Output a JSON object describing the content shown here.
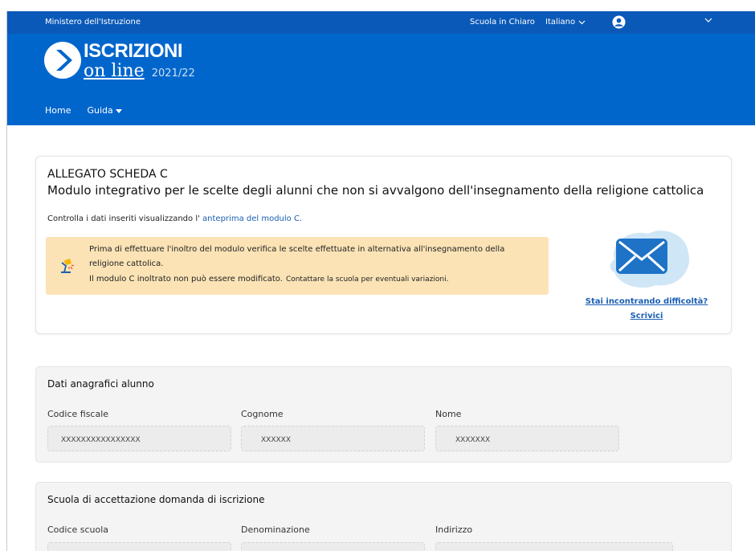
{
  "header": {
    "ministry": "Ministero dell'Istruzione",
    "scuola_link": "Scuola in Chiaro",
    "language": "Italiano",
    "brand_title": "ISCRIZIONI",
    "brand_subtitle": "on line",
    "brand_year": "2021/22",
    "nav": {
      "home": "Home",
      "guida": "Guida"
    }
  },
  "notice": {
    "tag": "ALLEGATO SCHEDA C",
    "title": "Modulo integrativo per le scelte degli alunni che non si avvalgono dell'insegnamento della religione cattolica",
    "check_prefix": "Controlla i dati inseriti visualizzando l'",
    "check_link": "anteprima del modulo C.",
    "warning_line1": "Prima di effettuare l'inoltro del modulo verifica le scelte effettuate in alternativa all'insegnamento della",
    "warning_line2": "religione cattolica.",
    "warning_line3a": "Il modulo C inoltrato non può essere modificato.",
    "warning_line3b": "Contattare la scuola per eventuali variazioni.",
    "help_line1": "Stai incontrando difficoltà?",
    "help_line2": "Scrivici"
  },
  "student": {
    "title": "Dati anagrafici alunno",
    "fields": [
      {
        "label": "Codice fiscale",
        "value": "XXXXXXXXXXXXXXXX"
      },
      {
        "label": "Cognome",
        "value": "XXXXXX"
      },
      {
        "label": "Nome",
        "value": "XXXXXXX"
      }
    ]
  },
  "school": {
    "title": "Scuola di accettazione domanda di iscrizione",
    "fields": [
      {
        "label": "Codice scuola",
        "value": ""
      },
      {
        "label": "Denominazione",
        "value": ""
      },
      {
        "label": "Indirizzo",
        "value": ""
      }
    ]
  },
  "colors": {
    "header_blue": "#0066cc",
    "slim_bar_blue": "#0a59b8",
    "warning_bg": "#fbe3b6",
    "link_blue": "#1a5fb4"
  }
}
